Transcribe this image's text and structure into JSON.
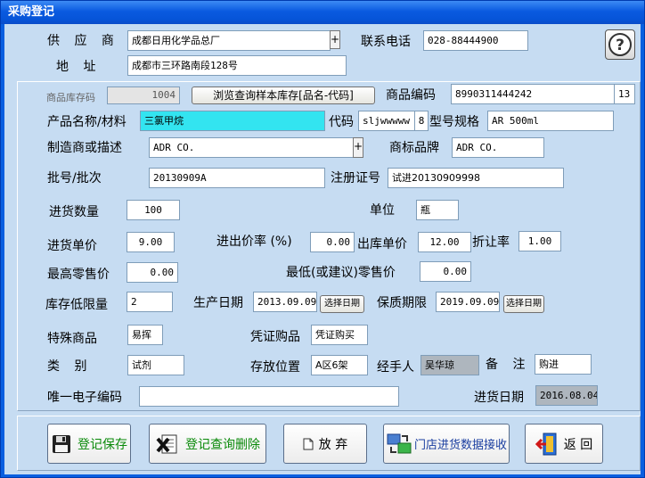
{
  "window": {
    "title": "采购登记"
  },
  "supplier": {
    "label": "供 应 商",
    "value": "成都日用化学品总厂",
    "plus": "+",
    "phone_label": "联系电话",
    "phone": "028-88444900",
    "address_label": "地  址",
    "address": "成都市三环路南段128号"
  },
  "stock": {
    "code_label": "商品库存码",
    "code": "1004",
    "browse_button": "浏览查询样本库存[品名-代码]"
  },
  "product": {
    "code_label": "商品编码",
    "code": "8990311444242",
    "code_suffix": "13",
    "name_label": "产品名称/材料",
    "name": "三氯甲烷",
    "short_code_label": "代码",
    "short_code": "sljwwwww",
    "short_code_num": "8",
    "model_label": "型号规格",
    "model": "AR    500ml",
    "maker_label": "制造商或描述",
    "maker": "ADR CO.",
    "maker_plus": "+",
    "brand_label": "商标品牌",
    "brand": "ADR CO.",
    "batch_label": "批号/批次",
    "batch": "20130909A",
    "reg_label": "注册证号",
    "reg": "试进20130909998"
  },
  "quantities": {
    "qty_label": "进货数量",
    "qty": "100",
    "unit_label": "单位",
    "unit": "瓶",
    "price_label": "进货单价",
    "price": "9.00",
    "rate_label": "进出价率 (%)",
    "rate": "0.00",
    "out_price_label": "出库单价",
    "out_price": "12.00",
    "discount_label": "折让率",
    "discount": "1.00",
    "max_retail_label": "最高零售价",
    "max_retail": "0.00",
    "min_retail_label": "最低(或建议)零售价",
    "min_retail": "0.00",
    "stock_min_label": "库存低限量",
    "stock_min": "2",
    "prod_date_label": "生产日期",
    "prod_date": "2013.09.09",
    "prod_date_btn": "选择日期",
    "expiry_label": "保质期限",
    "expiry": "2019.09.09",
    "expiry_btn": "选择日期"
  },
  "misc": {
    "special_label": "特殊商品",
    "special": "易挥",
    "voucher_label": "凭证购品",
    "voucher": "凭证购买",
    "category_label": "类  别",
    "category": "试剂",
    "location_label": "存放位置",
    "location": "A区6架",
    "handler_label": "经手人",
    "handler": "吴华琼",
    "note_label": "备  注",
    "note": "购进",
    "ecode_label": "唯一电子编码",
    "ecode": "",
    "in_date_label": "进货日期",
    "in_date": "2016.08.04"
  },
  "buttons": {
    "save": "登记保存",
    "query_delete": "登记查询删除",
    "abandon": "放 弃",
    "receive": "门店进货数据接收",
    "back": "返 回"
  },
  "colors": {
    "title_bar": "#0a5ae0",
    "client_bg": "#c6dcf2",
    "highlight": "#33e4f0"
  }
}
